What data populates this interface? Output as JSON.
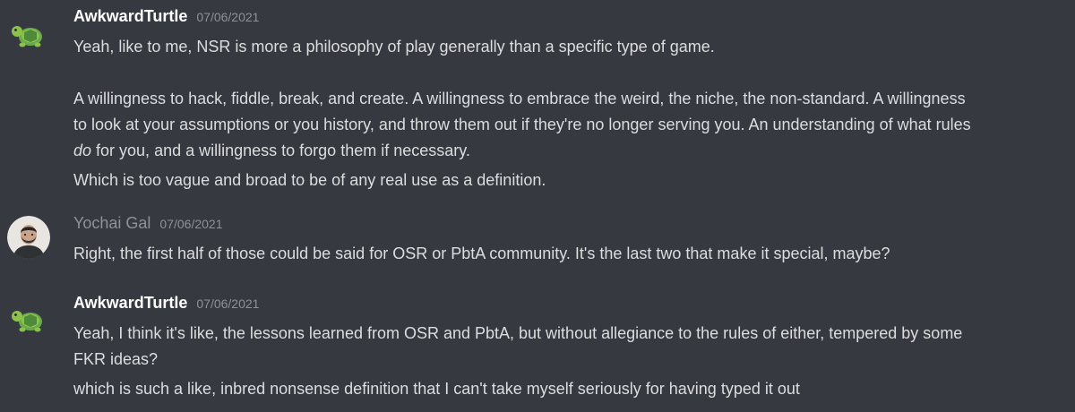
{
  "messages": [
    {
      "author": "AwkwardTurtle",
      "timestamp": "07/06/2021",
      "avatar_icon": "turtle-icon",
      "lines": {
        "l1": "Yeah, like to me, NSR is more a philosophy of play generally than a specific type of game.",
        "l2": "A willingness to hack, fiddle, break, and create. A willingness to embrace the weird, the niche, the non-standard. A willingness",
        "l3": "to look at your assumptions or you history, and throw them out if they're no longer serving you. An understanding of what rules",
        "l4_em": "do",
        "l4_rest": " for you, and a willingness to forgo them if necessary.",
        "l5": "Which is too vague and broad to be of any real use as a definition."
      }
    },
    {
      "author": "Yochai Gal",
      "timestamp": "07/06/2021",
      "avatar_icon": "user-photo-avatar",
      "lines": {
        "l1": "Right, the first half of those could be said for OSR or PbtA community. It's the last two that make it special, maybe?"
      }
    },
    {
      "author": "AwkwardTurtle",
      "timestamp": "07/06/2021",
      "avatar_icon": "turtle-icon",
      "lines": {
        "l1": "Yeah, I think it's like, the lessons learned from OSR and PbtA, but without allegiance to the rules of either, tempered by some",
        "l2": "FKR ideas?",
        "l3": "which is such a like, inbred nonsense definition that I can't take myself seriously for having typed it out"
      }
    }
  ],
  "colors": {
    "background": "#36393f",
    "text": "#dcddde",
    "username": "#ffffff",
    "username_muted": "#8e9297",
    "timestamp": "#8e9297"
  }
}
